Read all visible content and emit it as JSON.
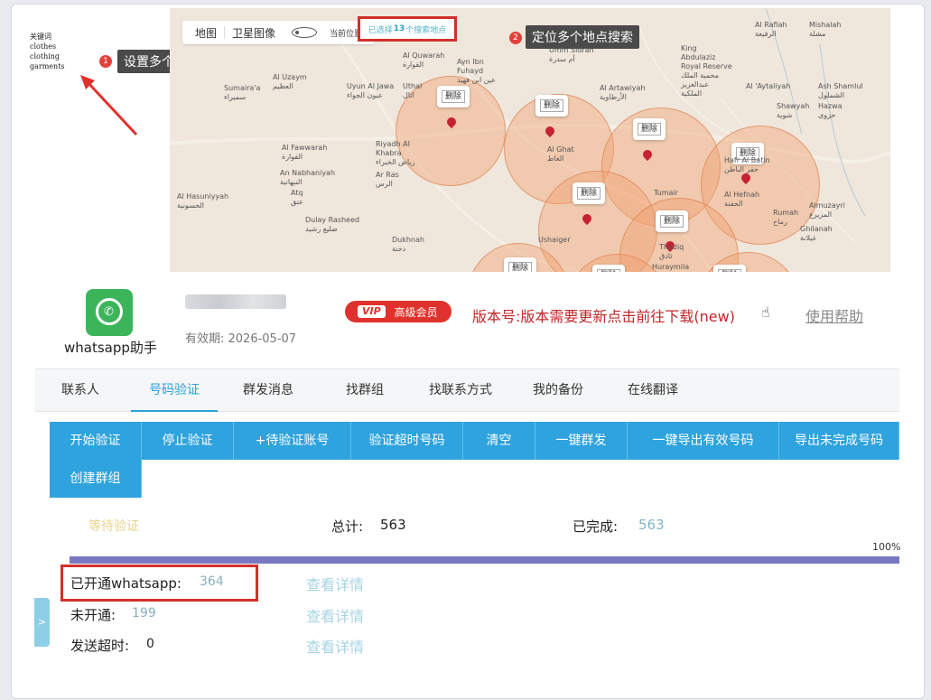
{
  "map": {
    "keywords_title": "关键词",
    "keywords": [
      "clothes",
      "clothing",
      "garments"
    ],
    "tab_map": "地图",
    "tab_satellite": "卫星图像",
    "current_location": "当前位置",
    "selected_prefix": "已选择",
    "selected_count": "13",
    "selected_suffix": "个搜索地点",
    "callout1_num": "1",
    "callout1_text": "设置多个产品关键词",
    "callout2_num": "2",
    "callout2_text": "定位多个地点搜索",
    "delete_label": "删除",
    "places": [
      "Al Quwarah\nالقوارة",
      "Ayn Ibn\nFuhayd\nعين ابن فهيد",
      "Umm Sidrah\nأم سدرة",
      "King\nAbdulaziz\nRoyal Reserve\nمحمية الملك\nعبدالعزيز\nالملكية",
      "Al Rafiah\nالرفيعة",
      "Mishalah\nمشلة",
      "Al Uzaym\nالعظيم",
      "Uyun Al Jawa\nعيون الجواء",
      "Uthal\nاثال",
      "Sumaira'a\nسميراء",
      "Al Artawiyah\nالأرطاوية",
      "Al 'Aytaliyah",
      "Ash Shamlul\nالشملول",
      "Hazwa\nحزوى",
      "Shawyah\nشوية",
      "Al Fawwarah\nالفوارة",
      "Riyadh Al\nKhabra\nرياض الخبراء",
      "Al Ghat\nالغاط",
      "An Nabhaniyah\nالنبهانية",
      "Ar Ras\nالرس",
      "Hafr Al Batin\nحفر الباطن",
      "Al Hasuniyyah\nالحسونية",
      "Atq\nعتق",
      "Al Hefnah\nالحفنة",
      "Rumah\nرماح",
      "Almuzayri\nالمزيرع",
      "Dulay Rasheed\nضليع رشيد",
      "Tumair",
      "Huraymila",
      "Thadiq\nثادق",
      "Dukhnah\nدخنة",
      "Ushaiger",
      "Ghilanah\nغيلانة"
    ]
  },
  "app": {
    "name": "whatsapp助手",
    "expire_label": "有效期: 2026-05-07",
    "vip_tag": "VIP",
    "vip_text": "高级会员",
    "version_text": "版本号:版本需要更新点击前往下载(new)",
    "help_link": "使用帮助"
  },
  "tabs": [
    "联系人",
    "号码验证",
    "群发消息",
    "找群组",
    "找联系方式",
    "我的备份",
    "在线翻译"
  ],
  "active_tab": "号码验证",
  "toolbar": [
    "开始验证",
    "停止验证",
    "+待验证账号",
    "验证超时号码",
    "清空",
    "一键群发",
    "一键导出有效号码",
    "导出未完成号码",
    "创建群组"
  ],
  "status": {
    "waiting": "等待验证",
    "total_label": "总计:",
    "total_value": "563",
    "done_label": "已完成:",
    "done_value": "563",
    "progress_percent": 100,
    "progress_text": "100%"
  },
  "results": [
    {
      "label": "已开通whatsapp:",
      "value": "364",
      "detail": "查看详情"
    },
    {
      "label": "未开通:",
      "value": "199",
      "detail": "查看详情"
    },
    {
      "label": "发送超时:",
      "value": "0",
      "detail": "查看详情"
    }
  ],
  "side_tab_glyph": ">",
  "colors": {
    "accent_blue": "#2ea3de",
    "highlight_red": "#d2302a",
    "vip_red": "#e0322c",
    "whatsapp_green": "#3cb55a",
    "progress_purple": "#7a78c2"
  }
}
